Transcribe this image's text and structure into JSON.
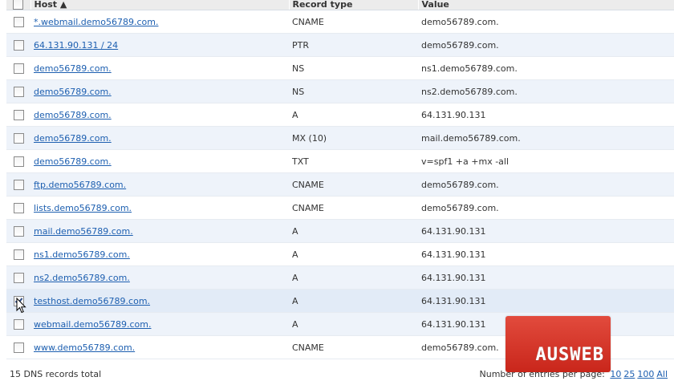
{
  "columns": {
    "host": "Host",
    "type": "Record type",
    "value": "Value"
  },
  "rows": [
    {
      "host": "*.webmail.demo56789.com.",
      "type": "CNAME",
      "value": "demo56789.com.",
      "checked": false
    },
    {
      "host": "64.131.90.131 / 24",
      "type": "PTR",
      "value": "demo56789.com.",
      "checked": false
    },
    {
      "host": "demo56789.com.",
      "type": "NS",
      "value": "ns1.demo56789.com.",
      "checked": false
    },
    {
      "host": "demo56789.com.",
      "type": "NS",
      "value": "ns2.demo56789.com.",
      "checked": false
    },
    {
      "host": "demo56789.com.",
      "type": "A",
      "value": "64.131.90.131",
      "checked": false
    },
    {
      "host": "demo56789.com.",
      "type": "MX (10)",
      "value": "mail.demo56789.com.",
      "checked": false
    },
    {
      "host": "demo56789.com.",
      "type": "TXT",
      "value": "v=spf1 +a +mx -all",
      "checked": false
    },
    {
      "host": "ftp.demo56789.com.",
      "type": "CNAME",
      "value": "demo56789.com.",
      "checked": false
    },
    {
      "host": "lists.demo56789.com.",
      "type": "CNAME",
      "value": "demo56789.com.",
      "checked": false
    },
    {
      "host": "mail.demo56789.com.",
      "type": "A",
      "value": "64.131.90.131",
      "checked": false
    },
    {
      "host": "ns1.demo56789.com.",
      "type": "A",
      "value": "64.131.90.131",
      "checked": false
    },
    {
      "host": "ns2.demo56789.com.",
      "type": "A",
      "value": "64.131.90.131",
      "checked": false
    },
    {
      "host": "testhost.demo56789.com.",
      "type": "A",
      "value": "64.131.90.131",
      "checked": true
    },
    {
      "host": "webmail.demo56789.com.",
      "type": "A",
      "value": "64.131.90.131",
      "checked": false
    },
    {
      "host": "www.demo56789.com.",
      "type": "CNAME",
      "value": "demo56789.com.",
      "checked": false
    }
  ],
  "footer": {
    "total": "15 DNS records total",
    "per_page_label": "Number of entries per page:",
    "per_page_options": [
      "10",
      "25",
      "100",
      "All"
    ],
    "per_page_current": "25"
  },
  "logo": {
    "text": "AUSWEB",
    "color": "#d9372b"
  }
}
